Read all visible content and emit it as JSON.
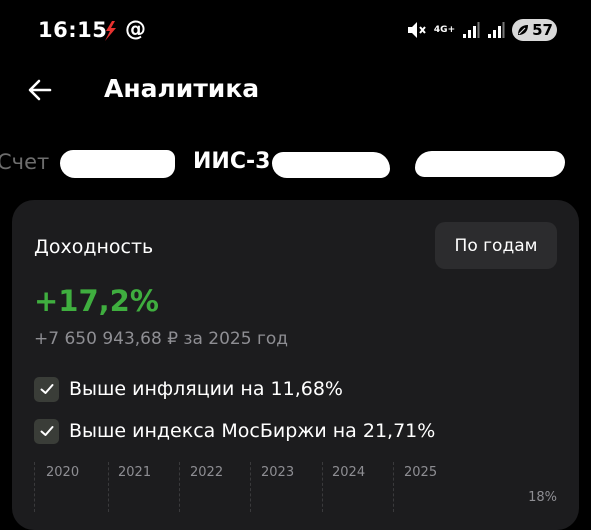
{
  "status_bar": {
    "time": "16:15",
    "at_symbol": "@",
    "network_type": "4G+",
    "battery_level": "57",
    "icons": [
      "app-notification-icon",
      "mute-icon",
      "signal-icon",
      "signal-icon",
      "battery-saver-icon"
    ]
  },
  "header": {
    "title": "Аналитика",
    "back_icon": "arrow-left-icon"
  },
  "accounts": {
    "items": [
      {
        "label": "Счет",
        "active": false
      },
      {
        "label": "ИИС-3",
        "active": true
      }
    ]
  },
  "card": {
    "title": "Доходность",
    "period_button": "По годам",
    "return_value": "+17,2%",
    "return_subtitle": "+7 650 943,68 ₽ за 2025 год",
    "checks": [
      {
        "label": "Выше инфляции на 11,68%",
        "checked": true
      },
      {
        "label": "Выше индекса МосБиржи на 21,71%",
        "checked": true
      }
    ],
    "chart": {
      "years": [
        "2020",
        "2021",
        "2022",
        "2023",
        "2024",
        "2025"
      ],
      "y_tick": "18%"
    }
  },
  "colors": {
    "background": "#000000",
    "card": "#1c1c1e",
    "positive": "#3fae3f",
    "muted_text": "#8e8e93"
  }
}
